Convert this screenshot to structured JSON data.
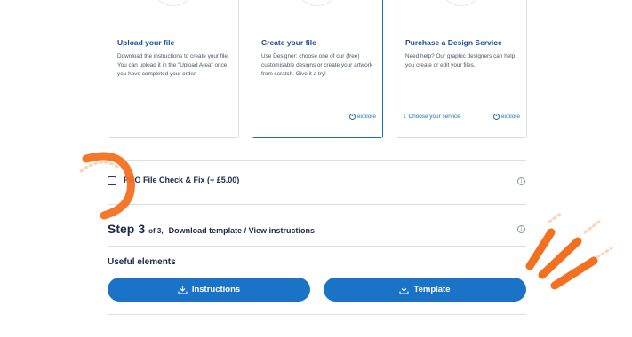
{
  "cards": [
    {
      "title": "Upload your file",
      "text": "Download the instructions to create your file. You can upload it in the \"Upload Area\" once you have completed your order.",
      "icon": "monitor-upload-icon"
    },
    {
      "title": "Create your file",
      "text": "Use Designer: choose one of our (free) customisable designs or create your artwork from scratch. Give it a try!",
      "link": "explore",
      "icon": "monitor-design-icon",
      "selected": true
    },
    {
      "title": "Purchase a Design Service",
      "text": "Need help? Our graphic designers can help you create or edit your files.",
      "secondary_link": "Choose your service",
      "link": "explore",
      "icon": "design-service-icon"
    }
  ],
  "pro_check": {
    "label": "PRO File Check & Fix (+ £5.00)",
    "checked": false
  },
  "step": {
    "word": "Step",
    "number": "3",
    "of": "of 3,",
    "description": "Download template / View instructions"
  },
  "useful": {
    "title": "Useful elements",
    "buttons": [
      "Instructions",
      "Template"
    ]
  },
  "colors": {
    "accent_blue": "#1a73c6",
    "title_blue": "#1a4e96",
    "decor_orange": "#f37021"
  }
}
